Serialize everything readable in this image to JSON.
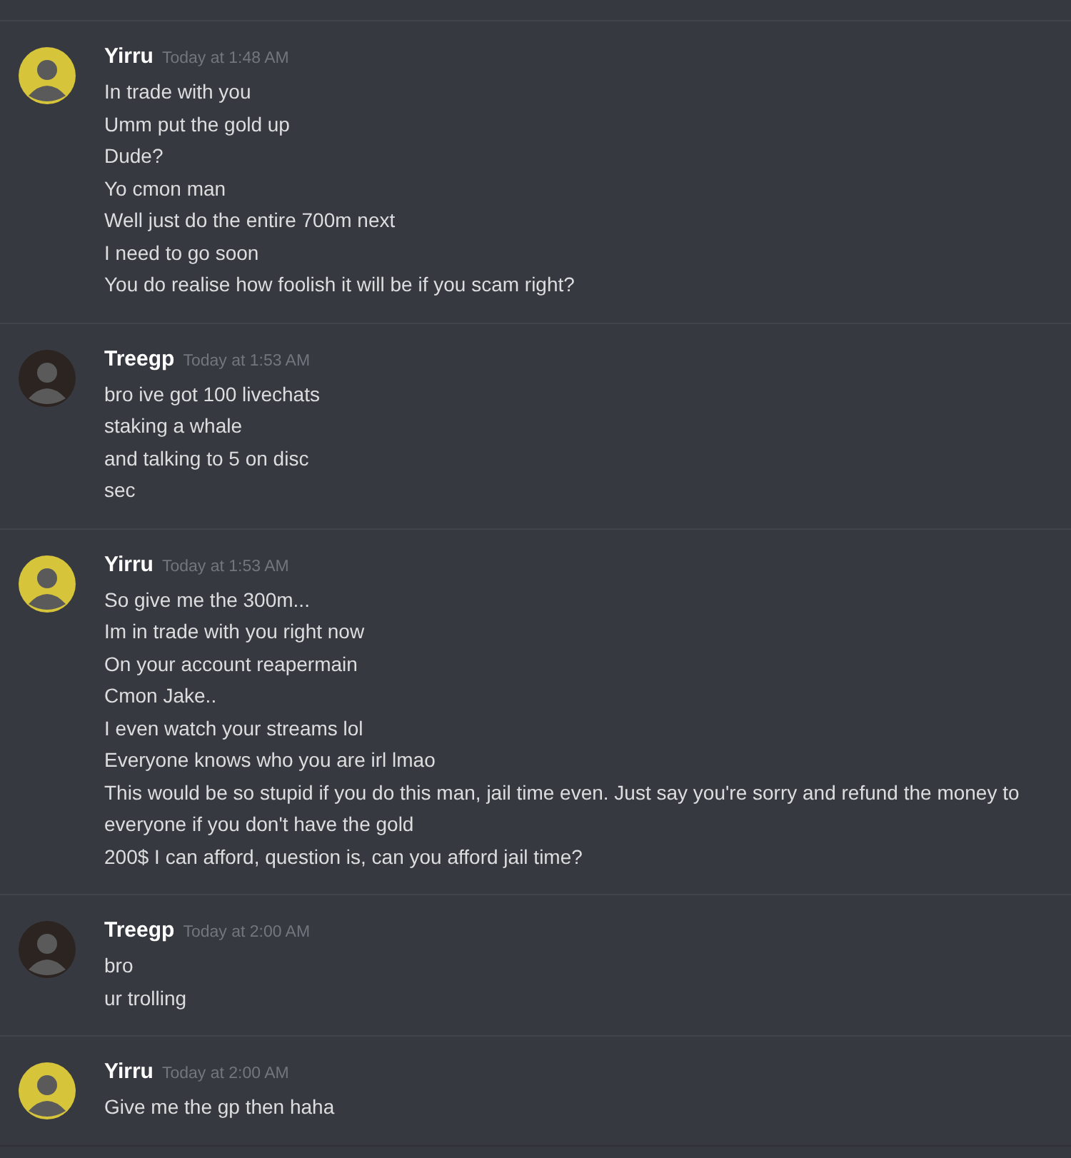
{
  "messages": [
    {
      "author": "Yirru",
      "color": "#d6c43a",
      "timestamp": "Today at 1:48 AM",
      "lines": [
        "In trade with you",
        "Umm put the gold up",
        "Dude?",
        "Yo cmon man",
        "Well just do the entire 700m next",
        "I need to go soon",
        "You do realise how foolish it will be if you scam right?"
      ]
    },
    {
      "author": "Treegp",
      "color": "#2b2420",
      "timestamp": "Today at 1:53 AM",
      "lines": [
        "bro ive got 100 livechats",
        "staking a whale",
        "and talking to 5 on disc",
        "sec"
      ]
    },
    {
      "author": "Yirru",
      "color": "#d6c43a",
      "timestamp": "Today at 1:53 AM",
      "lines": [
        "So give me the 300m...",
        "Im in trade with you right now",
        "On your account reapermain",
        "Cmon Jake..",
        "I even watch your streams lol",
        "Everyone knows who you are irl lmao",
        "This would be so stupid if you do this man, jail time even. Just say you're sorry and refund the money to everyone if you don't have the gold",
        "200$ I can afford, question is, can you afford jail time?"
      ]
    },
    {
      "author": "Treegp",
      "color": "#2b2420",
      "timestamp": "Today at 2:00 AM",
      "lines": [
        "bro",
        "ur trolling"
      ]
    },
    {
      "author": "Yirru",
      "color": "#d6c43a",
      "timestamp": "Today at 2:00 AM",
      "lines": [
        "Give me the gp then haha"
      ]
    }
  ]
}
